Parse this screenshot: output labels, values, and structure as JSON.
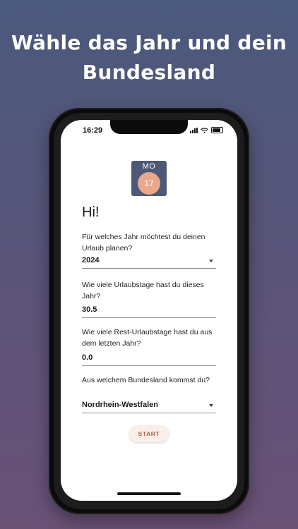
{
  "headline": {
    "line1": "Wähle das Jahr und dein",
    "line2": "Bundesland"
  },
  "status_bar": {
    "time": "16:29"
  },
  "calendar_icon": {
    "weekday": "MO",
    "day": "17"
  },
  "greeting": "Hi!",
  "form": {
    "year": {
      "question": "Für welches Jahr möchtest du deinen Urlaub planen?",
      "value": "2024"
    },
    "vacation_days": {
      "question": "Wie viele Urlaubstage hast du dieses Jahr?",
      "value": "30.5"
    },
    "remaining_days": {
      "question": "Wie viele Rest-Urlaubstage hast du aus dem letzten Jahr?",
      "value": "0.0"
    },
    "state": {
      "question": "Aus welchem Bundesland kommst du?",
      "value": "Nordrhein-Westfalen"
    }
  },
  "start_button": "START",
  "colors": {
    "accent": "#e9a88c",
    "calendar_bg": "#4e5878",
    "button_text": "#b0614a"
  }
}
